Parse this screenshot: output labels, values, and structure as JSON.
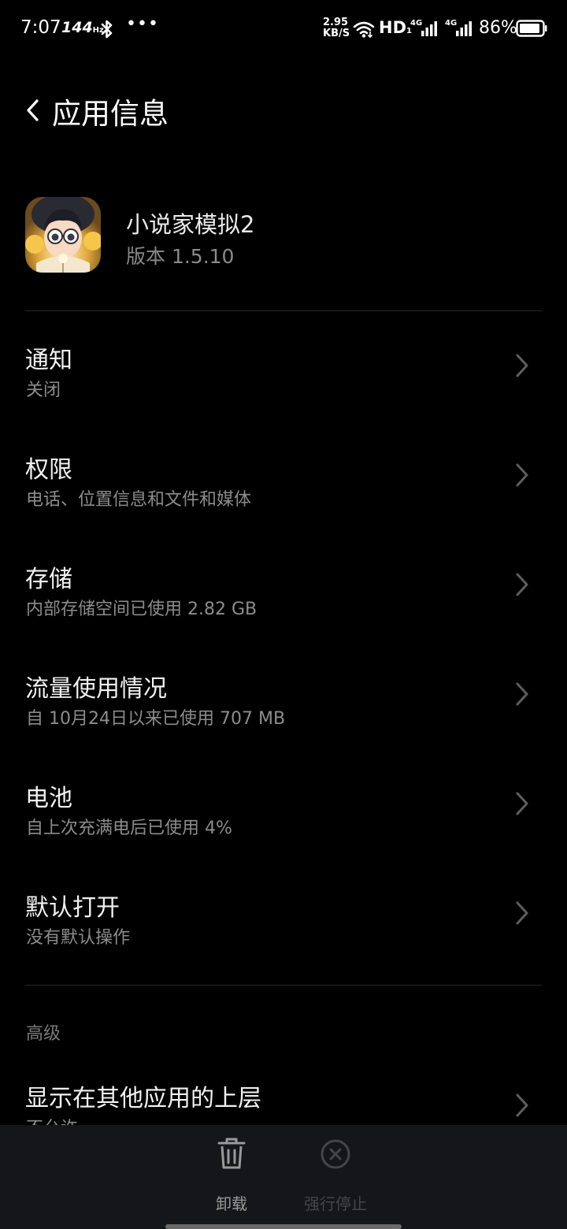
{
  "status_bar": {
    "time": "7:07",
    "refresh_rate": "144",
    "refresh_unit": "Hz",
    "dots": "•••",
    "net_speed_value": "2.95",
    "net_speed_unit": "KB/S",
    "hd_label": "HD",
    "hd_sub": "1",
    "sim1_label": "4G",
    "sim2_label": "4G",
    "battery_percent": "86%"
  },
  "header": {
    "title": "应用信息",
    "back_icon": "chevron-left-icon"
  },
  "app": {
    "name": "小说家模拟2",
    "version": "版本 1.5.10"
  },
  "settings": [
    {
      "title": "通知",
      "subtitle": "关闭"
    },
    {
      "title": "权限",
      "subtitle": "电话、位置信息和文件和媒体"
    },
    {
      "title": "存储",
      "subtitle": "内部存储空间已使用 2.82 GB"
    },
    {
      "title": "流量使用情况",
      "subtitle": "自 10月24日以来已使用 707 MB"
    },
    {
      "title": "电池",
      "subtitle": "自上次充满电后已使用 4%"
    },
    {
      "title": "默认打开",
      "subtitle": "没有默认操作"
    }
  ],
  "advanced": {
    "section_label": "高级",
    "items": [
      {
        "title": "显示在其他应用的上层",
        "subtitle": "不允许"
      }
    ]
  },
  "bottom_actions": {
    "uninstall_label": "卸载",
    "force_stop_label": "强行停止"
  },
  "colors": {
    "background": "#000000",
    "bottom_bar": "#141619",
    "primary_text": "#f2f2f2",
    "secondary_text": "#8c8c8c",
    "disabled_text": "#454545"
  }
}
